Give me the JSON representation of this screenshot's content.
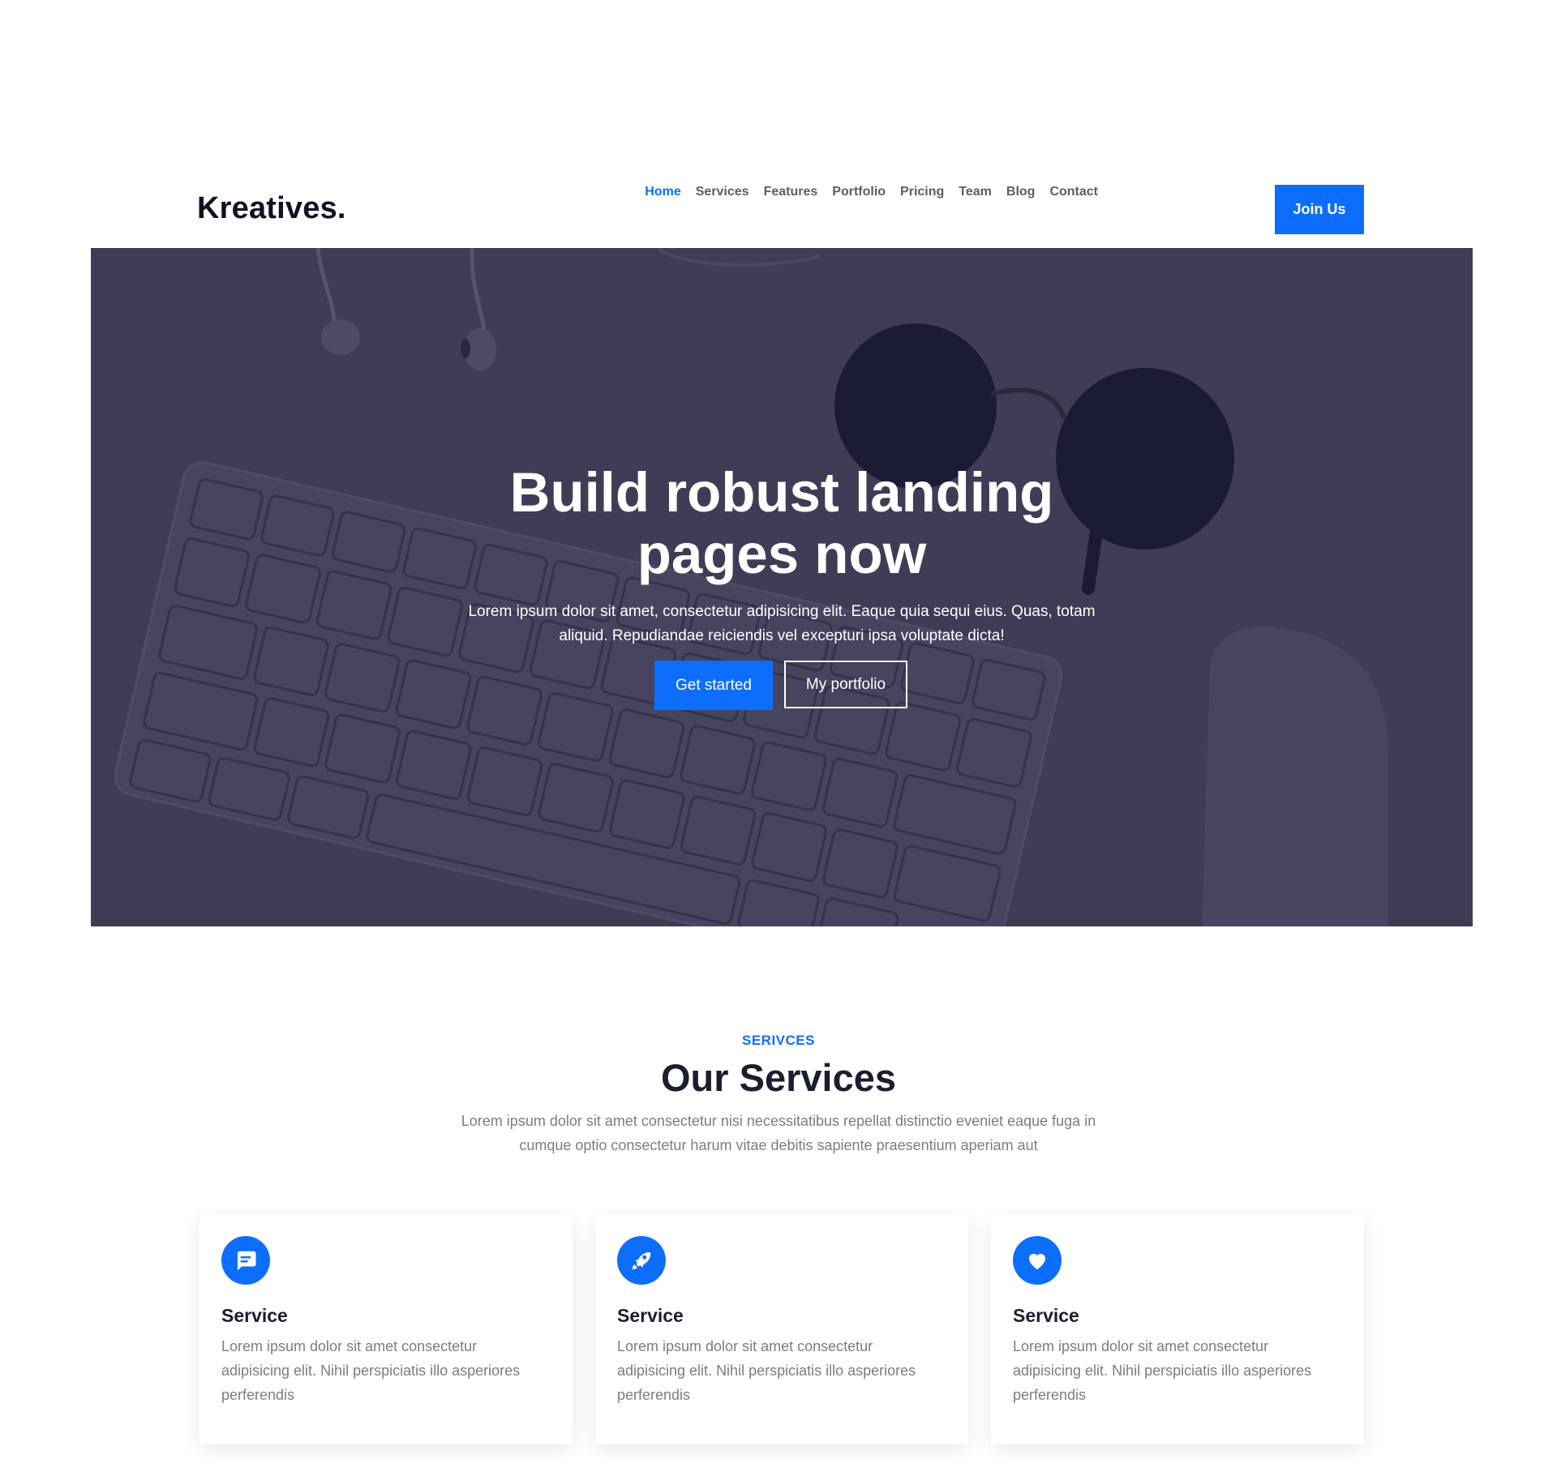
{
  "header": {
    "brand": "Kreatives.",
    "nav": [
      {
        "label": "Home",
        "active": true
      },
      {
        "label": "Services"
      },
      {
        "label": "Features"
      },
      {
        "label": "Portfolio"
      },
      {
        "label": "Pricing"
      },
      {
        "label": "Team"
      },
      {
        "label": "Blog"
      },
      {
        "label": "Contact"
      }
    ],
    "cta_label": "Join Us"
  },
  "hero": {
    "title_line1": "Build robust landing",
    "title_line2": "pages now",
    "text_line1": "Lorem ipsum dolor sit amet, consectetur adipisicing elit. Eaque quia sequi eius. Quas, totam",
    "text_line2": "aliquid. Repudiandae reiciendis vel excepturi ipsa voluptate dicta!",
    "primary_label": "Get started",
    "secondary_label": "My portfolio",
    "overlay_color": "#3f3d56"
  },
  "services": {
    "eyebrow": "SERIVCES",
    "title": "Our Services",
    "subtitle_line1": "Lorem ipsum dolor sit amet consectetur nisi necessitatibus repellat distinctio eveniet eaque fuga in",
    "subtitle_line2": "cumque optio consectetur harum vitae debitis sapiente praesentium aperiam aut",
    "cards": [
      {
        "icon": "chat-icon",
        "title": "Service",
        "text": "Lorem ipsum dolor sit amet consectetur adipisicing elit. Nihil perspiciatis illo asperiores perferendis"
      },
      {
        "icon": "rocket-icon",
        "title": "Service",
        "text": "Lorem ipsum dolor sit amet consectetur adipisicing elit. Nihil perspiciatis illo asperiores perferendis"
      },
      {
        "icon": "heart-icon",
        "title": "Service",
        "text": "Lorem ipsum dolor sit amet consectetur adipisicing elit. Nihil perspiciatis illo asperiores perferendis"
      }
    ]
  },
  "colors": {
    "accent": "#0d6efd",
    "dark": "#1b1e2e",
    "muted": "#7a7d88"
  }
}
